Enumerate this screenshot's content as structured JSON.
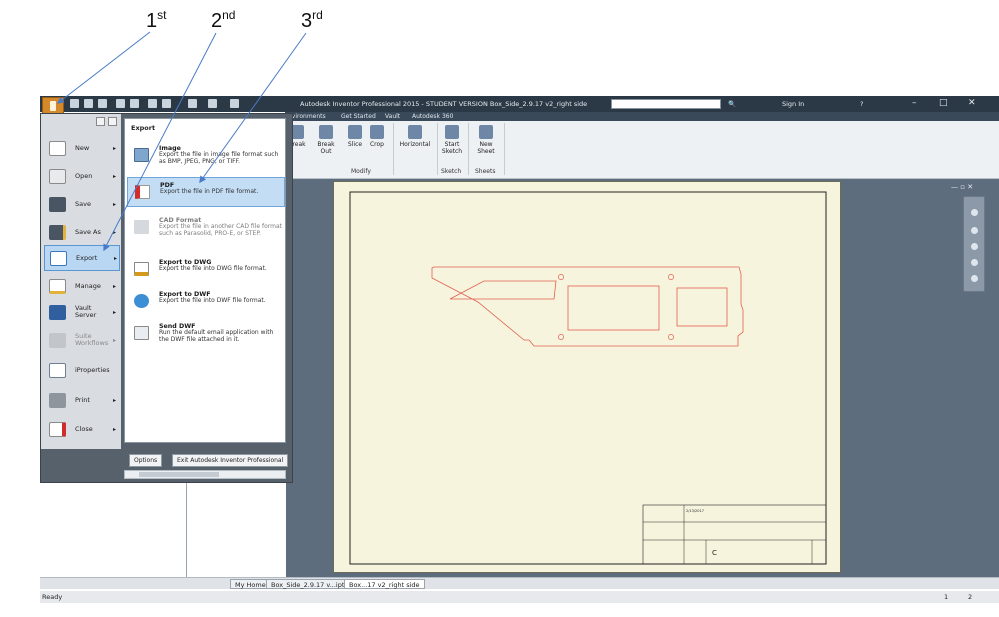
{
  "annotations": {
    "first": {
      "num": "1",
      "suffix": "st"
    },
    "second": {
      "num": "2",
      "suffix": "nd"
    },
    "third": {
      "num": "3",
      "suffix": "rd"
    }
  },
  "window": {
    "title": "Autodesk Inventor Professional 2015 - STUDENT VERSION   Box_Side_2.9.17 v2_right side",
    "sign_in": "Sign In",
    "min": "–",
    "max": "□",
    "close": "✕"
  },
  "ribbon": {
    "tabs": [
      "nvironments",
      "Get Started",
      "Vault",
      "Autodesk 360"
    ],
    "buttons": [
      "Break",
      "Break Out",
      "Slice",
      "Crop",
      "Horizontal",
      "Start Sketch",
      "New Sheet"
    ],
    "groups": {
      "modify": "Modify",
      "sketch": "Sketch",
      "sheets": "Sheets"
    }
  },
  "app_menu": {
    "left_items": [
      {
        "label": "New"
      },
      {
        "label": "Open"
      },
      {
        "label": "Save"
      },
      {
        "label": "Save As"
      },
      {
        "label": "Export"
      },
      {
        "label": "Manage"
      },
      {
        "label": "Vault Server"
      },
      {
        "label": "Suite Workflows"
      },
      {
        "label": "iProperties"
      },
      {
        "label": "Print"
      },
      {
        "label": "Close"
      }
    ],
    "submenu_header": "Export",
    "submenu_items": [
      {
        "title": "Image",
        "desc": "Export the file in image file format such as BMP, JPEG, PNG, or TIFF."
      },
      {
        "title": "PDF",
        "desc": "Export the file in PDF file format."
      },
      {
        "title": "CAD Format",
        "desc": "Export the file in another CAD file format such as Parasolid, PRO-E, or STEP."
      },
      {
        "title": "Export to DWG",
        "desc": "Export the file into DWG file format."
      },
      {
        "title": "Export to DWF",
        "desc": "Export the file into DWF file format."
      },
      {
        "title": "Send DWF",
        "desc": "Run the default email application with the DWF file attached in it."
      }
    ],
    "options_button": "Options",
    "exit_button": "Exit Autodesk Inventor Professional"
  },
  "document_tabs": [
    "My Home",
    "Box_Side_2.9.17 v...ipt",
    "Box...17 v2_right side"
  ],
  "status": {
    "left": "Ready",
    "page1": "1",
    "page2": "2"
  },
  "title_block": {
    "date": "2/13/2017",
    "size": "C"
  },
  "colors": {
    "accent_orange": "#d48a2a",
    "selection": "#b9d7f3",
    "drawing_line": "#e0604f",
    "sheet": "#f7f4de",
    "workspace": "#5d6d7e"
  }
}
